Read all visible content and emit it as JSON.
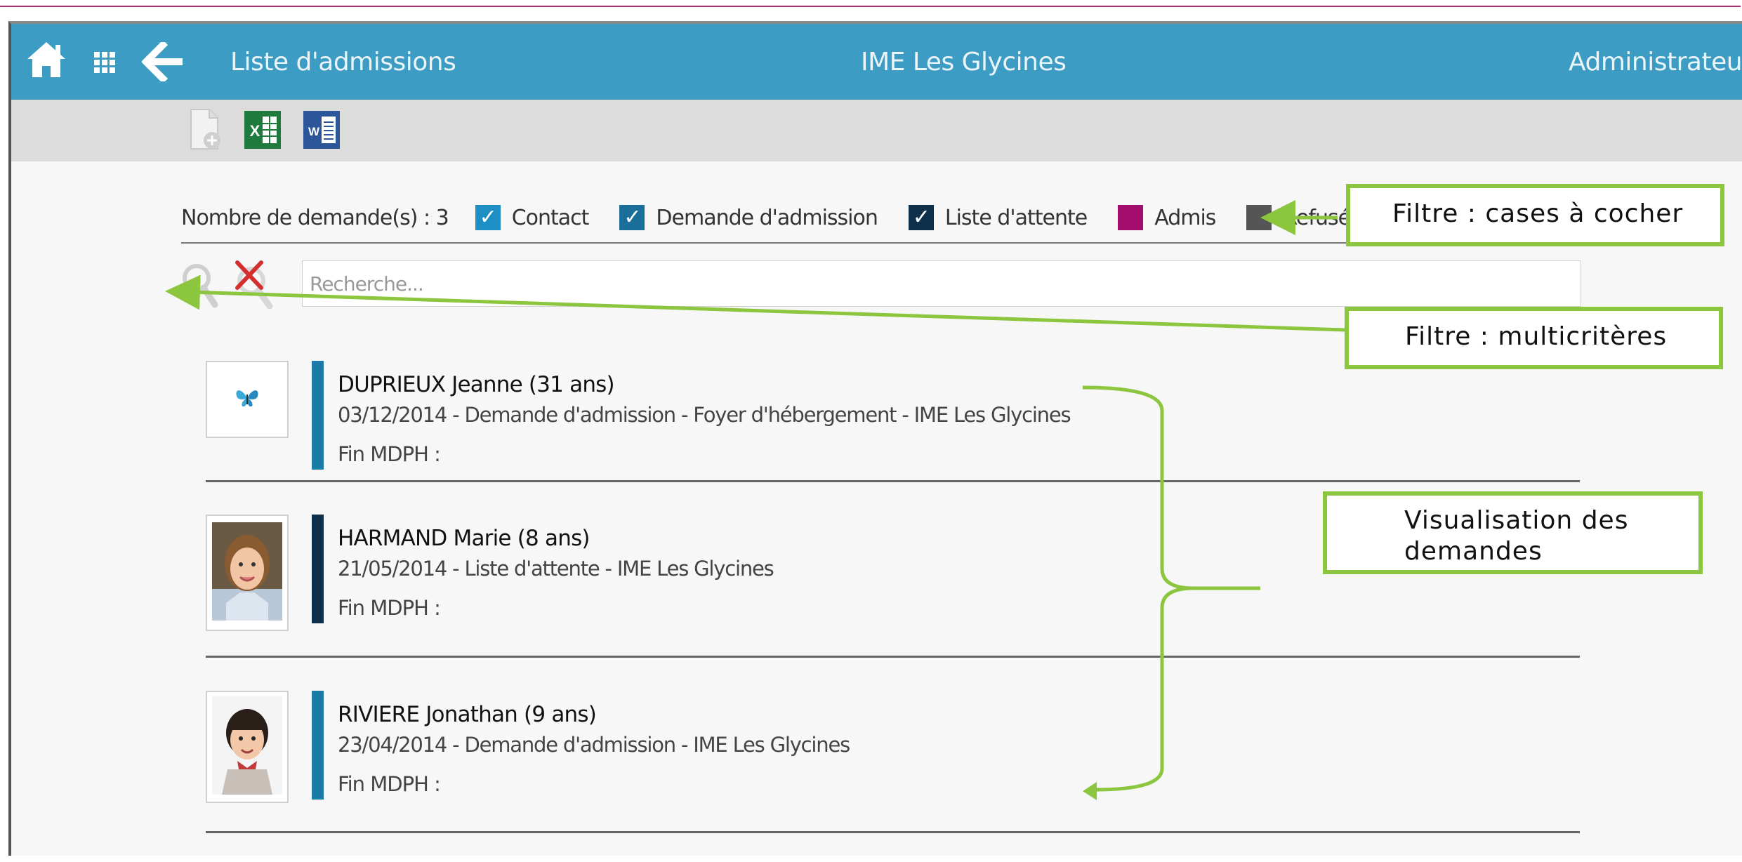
{
  "header": {
    "page_title": "Liste d'admissions",
    "establishment": "IME Les Glycines",
    "user": "Administrateur",
    "colors": {
      "bar": "#3d9cc4"
    }
  },
  "toolbar": {
    "icons": [
      "new-document-icon",
      "excel-export-icon",
      "word-export-icon"
    ],
    "excel_letter": "X",
    "word_letter": "W"
  },
  "filters": {
    "count_text": "Nombre de demande(s) : 3",
    "items": [
      {
        "label": "Contact",
        "checked": true,
        "color": "#1e8fc4"
      },
      {
        "label": "Demande d'admission",
        "checked": true,
        "color": "#1a6f9a"
      },
      {
        "label": "Liste d'attente",
        "checked": true,
        "color": "#0e2f4a"
      },
      {
        "label": "Admis",
        "checked": false,
        "color": "#a30d6e"
      },
      {
        "label": "Refusé",
        "checked": false,
        "color": "#555555"
      }
    ]
  },
  "search": {
    "placeholder": "Recherche..."
  },
  "requests": [
    {
      "name": "DUPRIEUX Jeanne (31 ans)",
      "detail": "03/12/2014 - Demande d'admission - Foyer d'hébergement - IME Les Glycines",
      "mdph": "Fin MDPH :",
      "status_color": "#1a7aa8",
      "avatar": "butterfly-icon"
    },
    {
      "name": "HARMAND Marie (8 ans)",
      "detail": "21/05/2014 - Liste d'attente - IME Les Glycines",
      "mdph": "Fin MDPH :",
      "status_color": "#0e2f4a",
      "avatar": "child-photo"
    },
    {
      "name": "RIVIERE Jonathan (9 ans)",
      "detail": "23/04/2014 - Demande d'admission - IME Les Glycines",
      "mdph": "Fin MDPH :",
      "status_color": "#1a7aa8",
      "avatar": "child-photo"
    }
  ],
  "annotations": {
    "checkbox_filter": "Filtre : cases à cocher",
    "multi_filter": "Filtre : multicritères",
    "visualisation_line1": "Visualisation des",
    "visualisation_line2": "demandes",
    "color": "#8cc63f"
  }
}
